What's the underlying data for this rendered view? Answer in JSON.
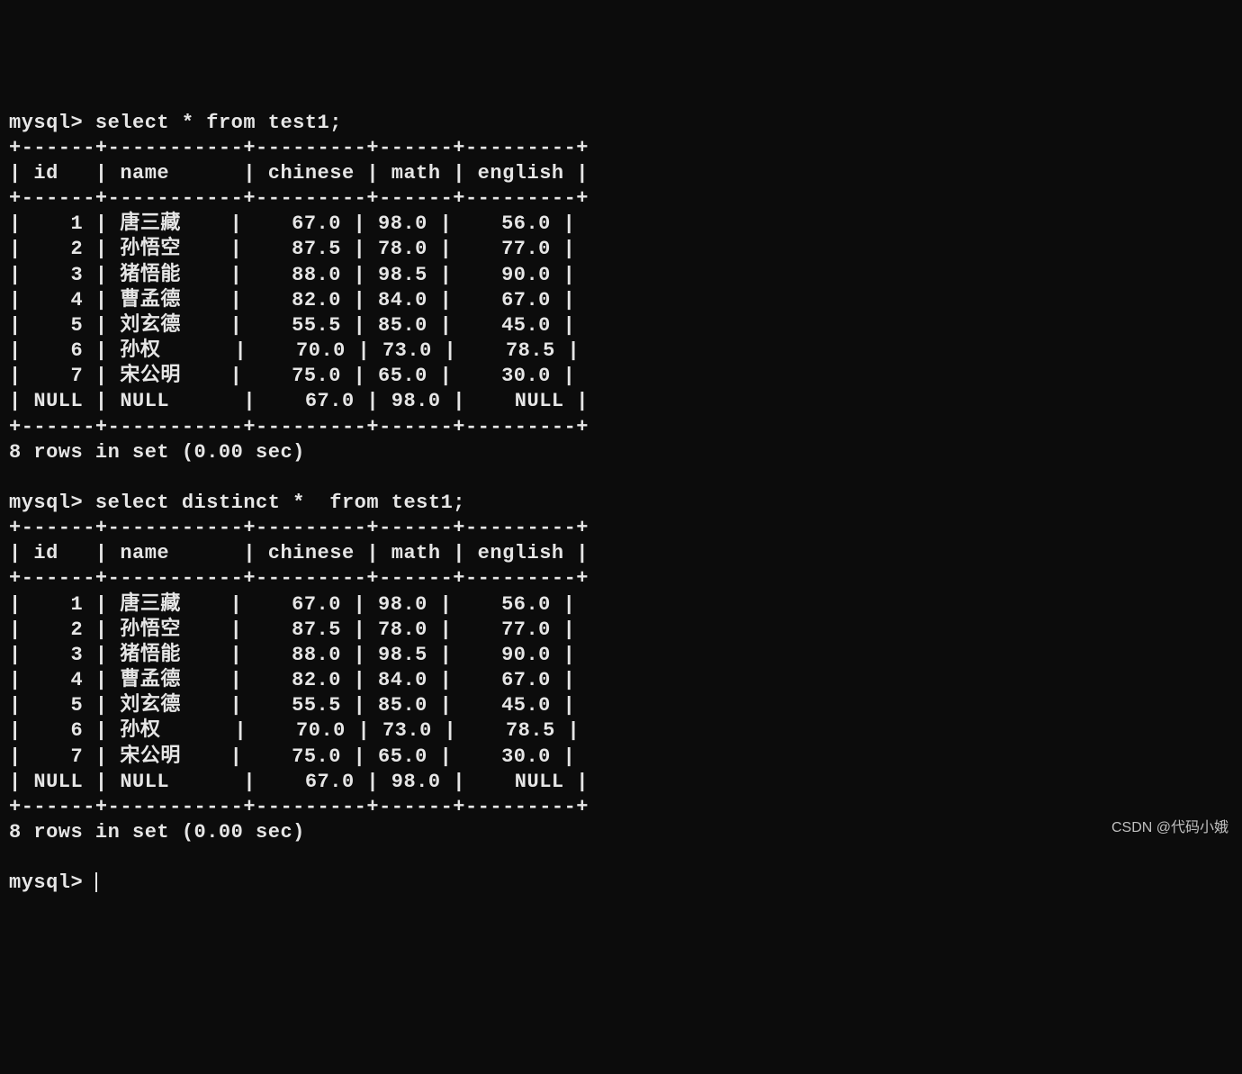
{
  "prompt": "mysql>",
  "query1": "select * from test1;",
  "query2": "select distinct *  from test1;",
  "border": "+------+-----------+---------+------+---------+",
  "header": "| id   | name      | chinese | math | english |",
  "table1": {
    "rows": [
      "|    1 | 唐三藏    |    67.0 | 98.0 |    56.0 |",
      "|    2 | 孙悟空    |    87.5 | 78.0 |    77.0 |",
      "|    3 | 猪悟能    |    88.0 | 98.5 |    90.0 |",
      "|    4 | 曹孟德    |    82.0 | 84.0 |    67.0 |",
      "|    5 | 刘玄德    |    55.5 | 85.0 |    45.0 |",
      "|    6 | 孙权      |    70.0 | 73.0 |    78.5 |",
      "|    7 | 宋公明    |    75.0 | 65.0 |    30.0 |",
      "| NULL | NULL      |    67.0 | 98.0 |    NULL |"
    ]
  },
  "table2": {
    "rows": [
      "|    1 | 唐三藏    |    67.0 | 98.0 |    56.0 |",
      "|    2 | 孙悟空    |    87.5 | 78.0 |    77.0 |",
      "|    3 | 猪悟能    |    88.0 | 98.5 |    90.0 |",
      "|    4 | 曹孟德    |    82.0 | 84.0 |    67.0 |",
      "|    5 | 刘玄德    |    55.5 | 85.0 |    45.0 |",
      "|    6 | 孙权      |    70.0 | 73.0 |    78.5 |",
      "|    7 | 宋公明    |    75.0 | 65.0 |    30.0 |",
      "| NULL | NULL      |    67.0 | 98.0 |    NULL |"
    ]
  },
  "result_msg": "8 rows in set (0.00 sec)",
  "watermark": "CSDN @代码小娥",
  "chart_data": {
    "type": "table",
    "tables": [
      {
        "query": "select * from test1;",
        "columns": [
          "id",
          "name",
          "chinese",
          "math",
          "english"
        ],
        "rows": [
          {
            "id": 1,
            "name": "唐三藏",
            "chinese": 67.0,
            "math": 98.0,
            "english": 56.0
          },
          {
            "id": 2,
            "name": "孙悟空",
            "chinese": 87.5,
            "math": 78.0,
            "english": 77.0
          },
          {
            "id": 3,
            "name": "猪悟能",
            "chinese": 88.0,
            "math": 98.5,
            "english": 90.0
          },
          {
            "id": 4,
            "name": "曹孟德",
            "chinese": 82.0,
            "math": 84.0,
            "english": 67.0
          },
          {
            "id": 5,
            "name": "刘玄德",
            "chinese": 55.5,
            "math": 85.0,
            "english": 45.0
          },
          {
            "id": 6,
            "name": "孙权",
            "chinese": 70.0,
            "math": 73.0,
            "english": 78.5
          },
          {
            "id": 7,
            "name": "宋公明",
            "chinese": 75.0,
            "math": 65.0,
            "english": 30.0
          },
          {
            "id": null,
            "name": null,
            "chinese": 67.0,
            "math": 98.0,
            "english": null
          }
        ],
        "row_count": 8,
        "time_sec": 0.0
      },
      {
        "query": "select distinct *  from test1;",
        "columns": [
          "id",
          "name",
          "chinese",
          "math",
          "english"
        ],
        "rows": [
          {
            "id": 1,
            "name": "唐三藏",
            "chinese": 67.0,
            "math": 98.0,
            "english": 56.0
          },
          {
            "id": 2,
            "name": "孙悟空",
            "chinese": 87.5,
            "math": 78.0,
            "english": 77.0
          },
          {
            "id": 3,
            "name": "猪悟能",
            "chinese": 88.0,
            "math": 98.5,
            "english": 90.0
          },
          {
            "id": 4,
            "name": "曹孟德",
            "chinese": 82.0,
            "math": 84.0,
            "english": 67.0
          },
          {
            "id": 5,
            "name": "刘玄德",
            "chinese": 55.5,
            "math": 85.0,
            "english": 45.0
          },
          {
            "id": 6,
            "name": "孙权",
            "chinese": 70.0,
            "math": 73.0,
            "english": 78.5
          },
          {
            "id": 7,
            "name": "宋公明",
            "chinese": 75.0,
            "math": 65.0,
            "english": 30.0
          },
          {
            "id": null,
            "name": null,
            "chinese": 67.0,
            "math": 98.0,
            "english": null
          }
        ],
        "row_count": 8,
        "time_sec": 0.0
      }
    ]
  }
}
